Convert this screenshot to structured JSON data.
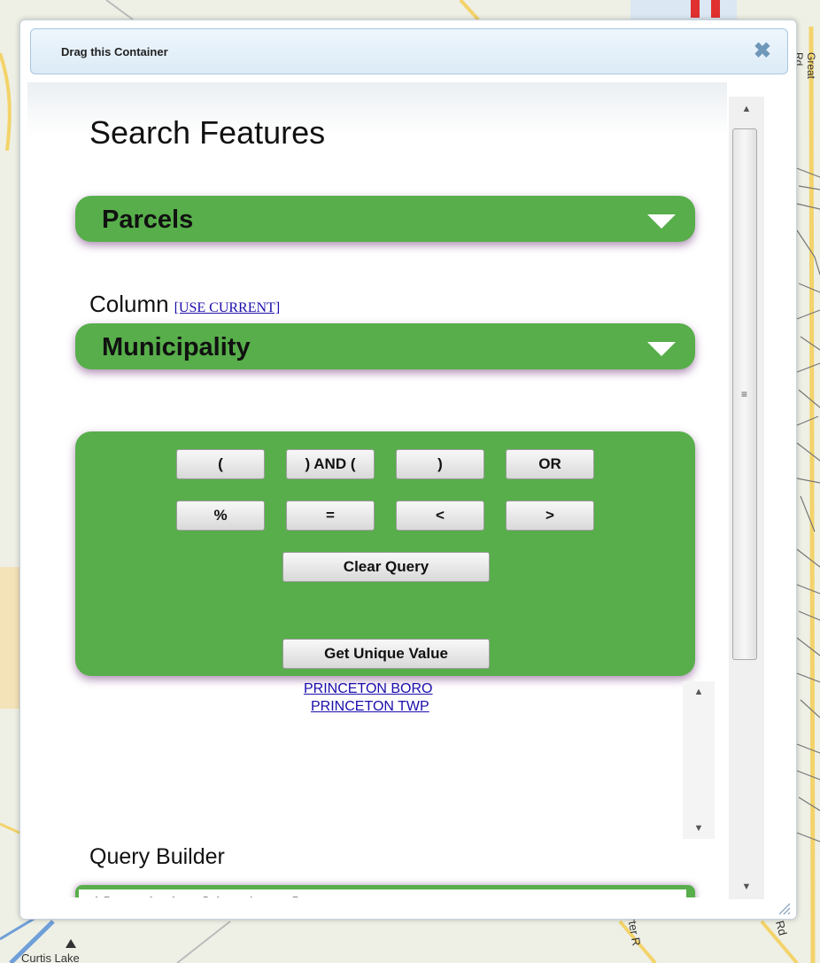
{
  "map": {
    "road_labels": [
      "Great Rd",
      "rter R",
      "Rd",
      "Curtis Lake"
    ]
  },
  "panel": {
    "drag_title": "Drag this Container",
    "close_icon": "close-icon",
    "heading": "Search Features",
    "layer_select": {
      "value": "Parcels",
      "icon": "chevron-down-icon"
    },
    "column": {
      "label": "Column",
      "use_current_link": "[USE CURRENT]",
      "value": "Municipality"
    },
    "operators": {
      "row1": [
        "(",
        ") AND (",
        ")",
        "OR"
      ],
      "row2": [
        "%",
        "=",
        "<",
        ">"
      ],
      "clear_query": "Clear Query",
      "get_unique_value": "Get Unique Value"
    },
    "unique_values": [
      "PRINCETON BORO",
      "PRINCETON TWP"
    ],
    "query_builder": {
      "label": "Query Builder",
      "value": "([Municipality|MUN]"
    },
    "colors": {
      "accent_green": "#57ae4a",
      "link_blue": "#1a0dab",
      "header_blue": "#dcebf7"
    }
  }
}
